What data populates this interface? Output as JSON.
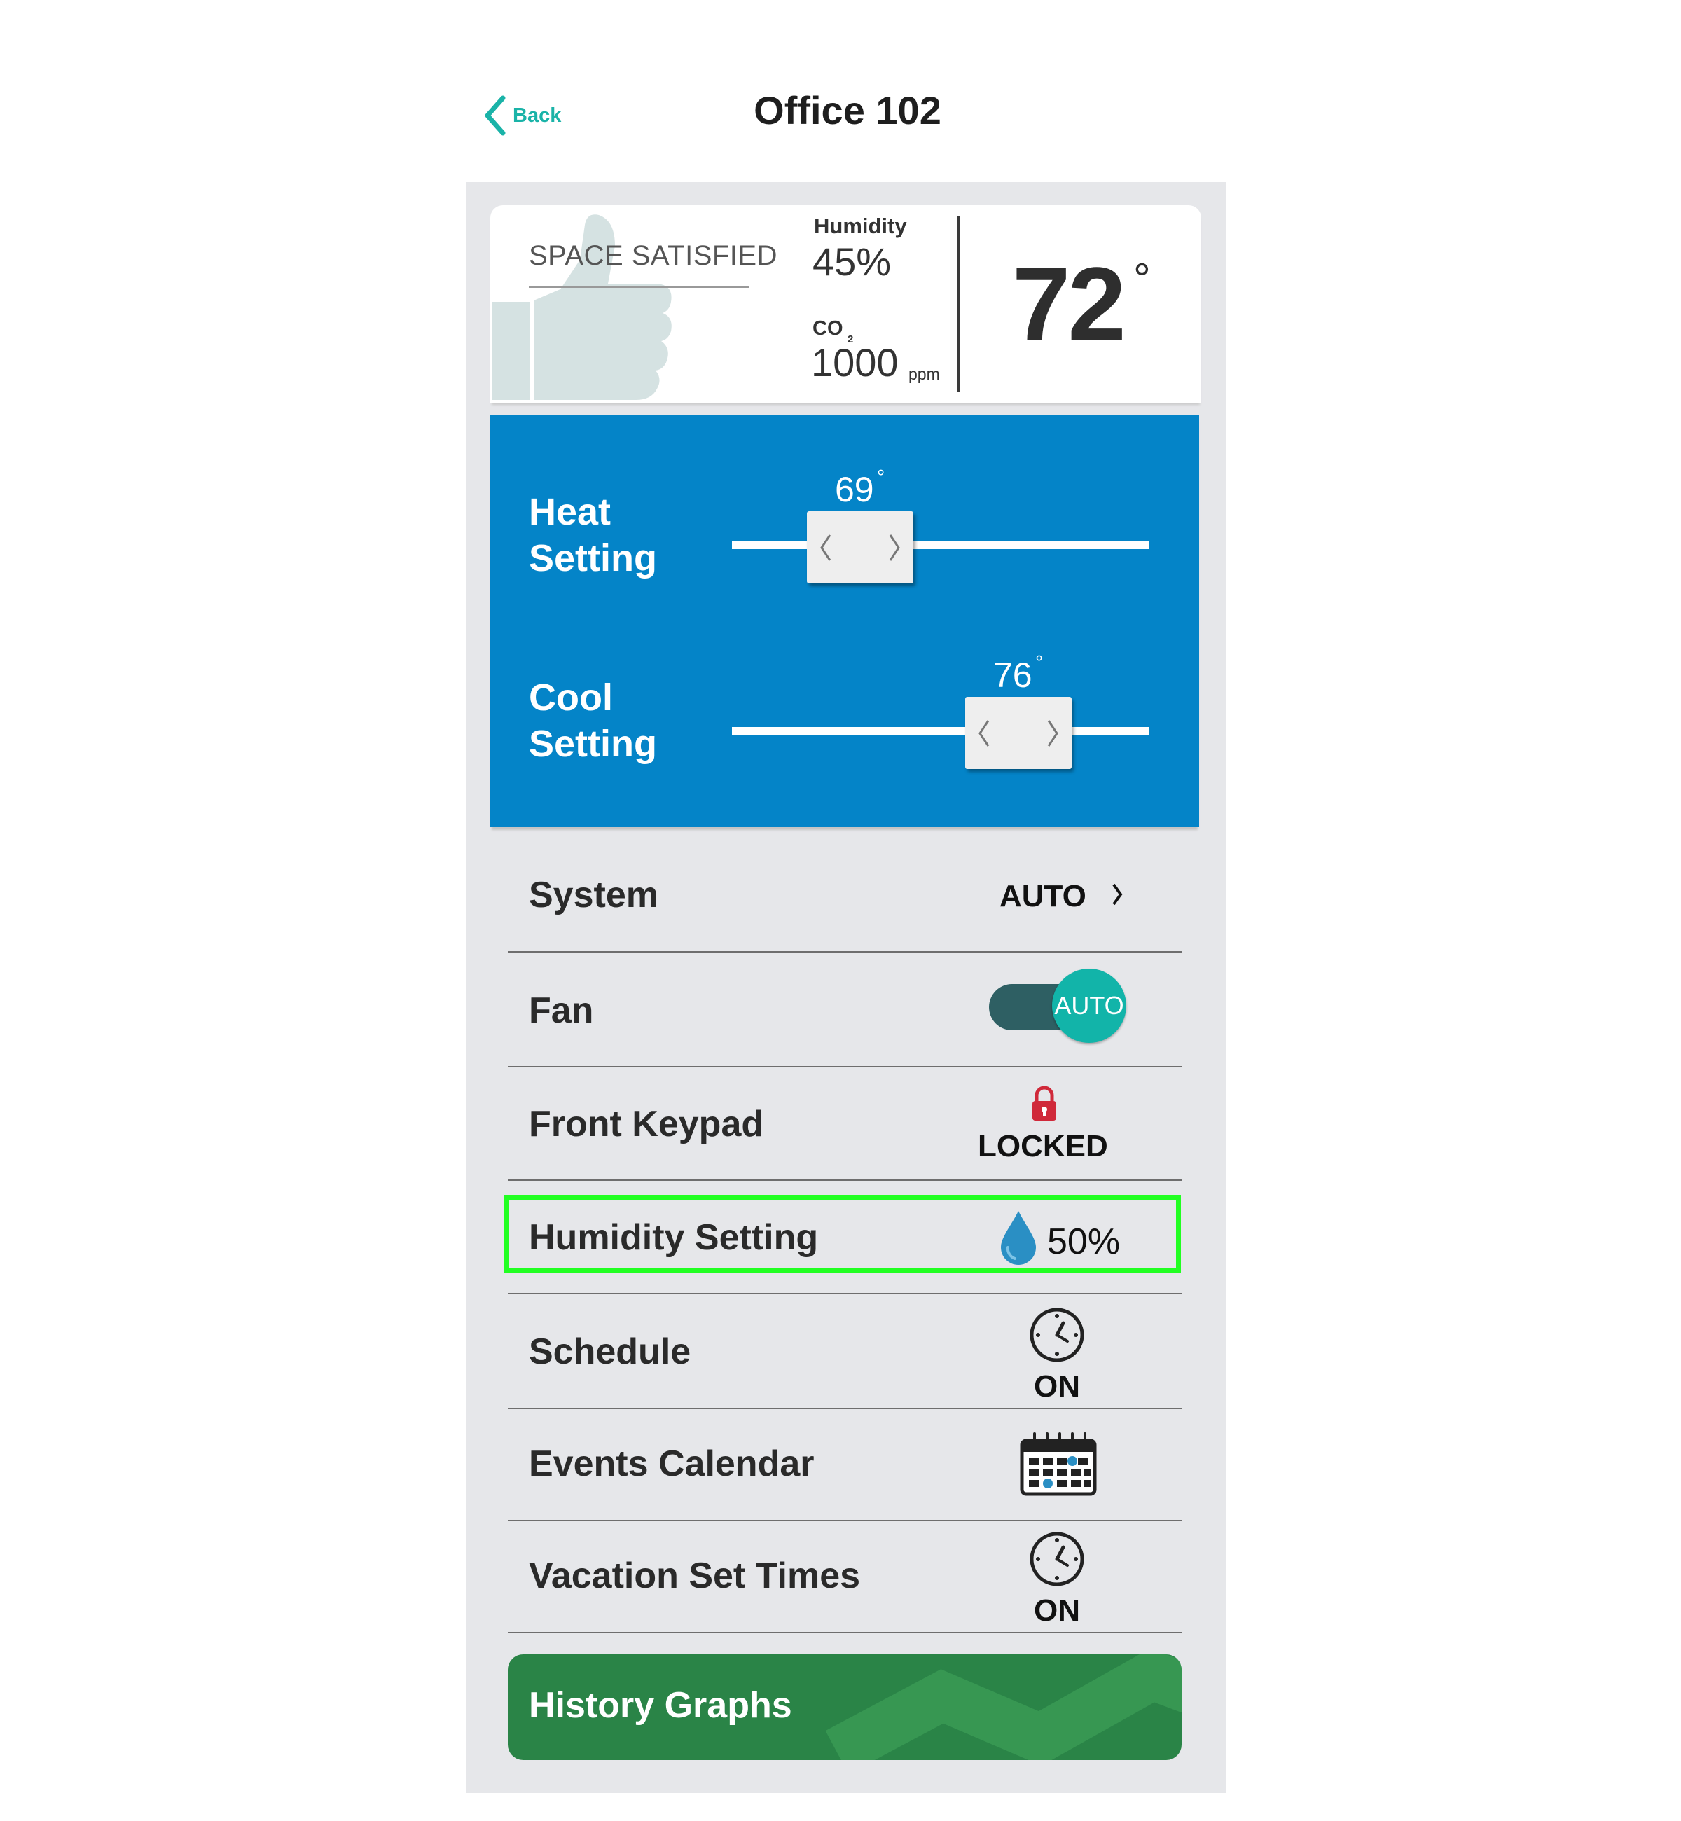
{
  "header": {
    "back_label": "Back",
    "title": "Office 102"
  },
  "status": {
    "space_status": "SPACE SATISFIED",
    "humidity_label": "Humidity",
    "humidity_value": "45%",
    "co2_label": "CO",
    "co2_subscript": "2",
    "co2_value": "1000",
    "co2_unit": "ppm",
    "temperature": "72",
    "degree_symbol": "°"
  },
  "setpoints": {
    "heat": {
      "label_line1": "Heat",
      "label_line2": "Setting",
      "value": "69",
      "degree": "°"
    },
    "cool": {
      "label_line1": "Cool",
      "label_line2": "Setting",
      "value": "76",
      "degree": "°"
    }
  },
  "rows": {
    "system": {
      "label": "System",
      "value": "AUTO"
    },
    "fan": {
      "label": "Fan",
      "value": "AUTO"
    },
    "front_keypad": {
      "label": "Front Keypad",
      "value": "LOCKED"
    },
    "humidity_setting": {
      "label": "Humidity Setting",
      "value": "50%"
    },
    "schedule": {
      "label": "Schedule",
      "value": "ON"
    },
    "events_calendar": {
      "label": "Events Calendar"
    },
    "vacation": {
      "label": "Vacation Set Times",
      "value": "ON"
    }
  },
  "history": {
    "label": "History Graphs"
  },
  "colors": {
    "accent_teal": "#1ab3a8",
    "setpoint_blue": "#0484c8",
    "fan_track": "#2e5f63",
    "lock_red": "#d0293a",
    "drop_blue": "#2a8fc4",
    "history_green": "#2a8447",
    "highlight_green": "#22ff22",
    "panel_gray": "#e6e7ea"
  },
  "icons": {
    "back": "chevron-left-icon",
    "thumb": "thumbs-up-icon",
    "lock": "lock-icon",
    "drop": "water-drop-icon",
    "clock": "clock-icon",
    "calendar": "calendar-icon",
    "chevron": "chevron-right-icon"
  }
}
